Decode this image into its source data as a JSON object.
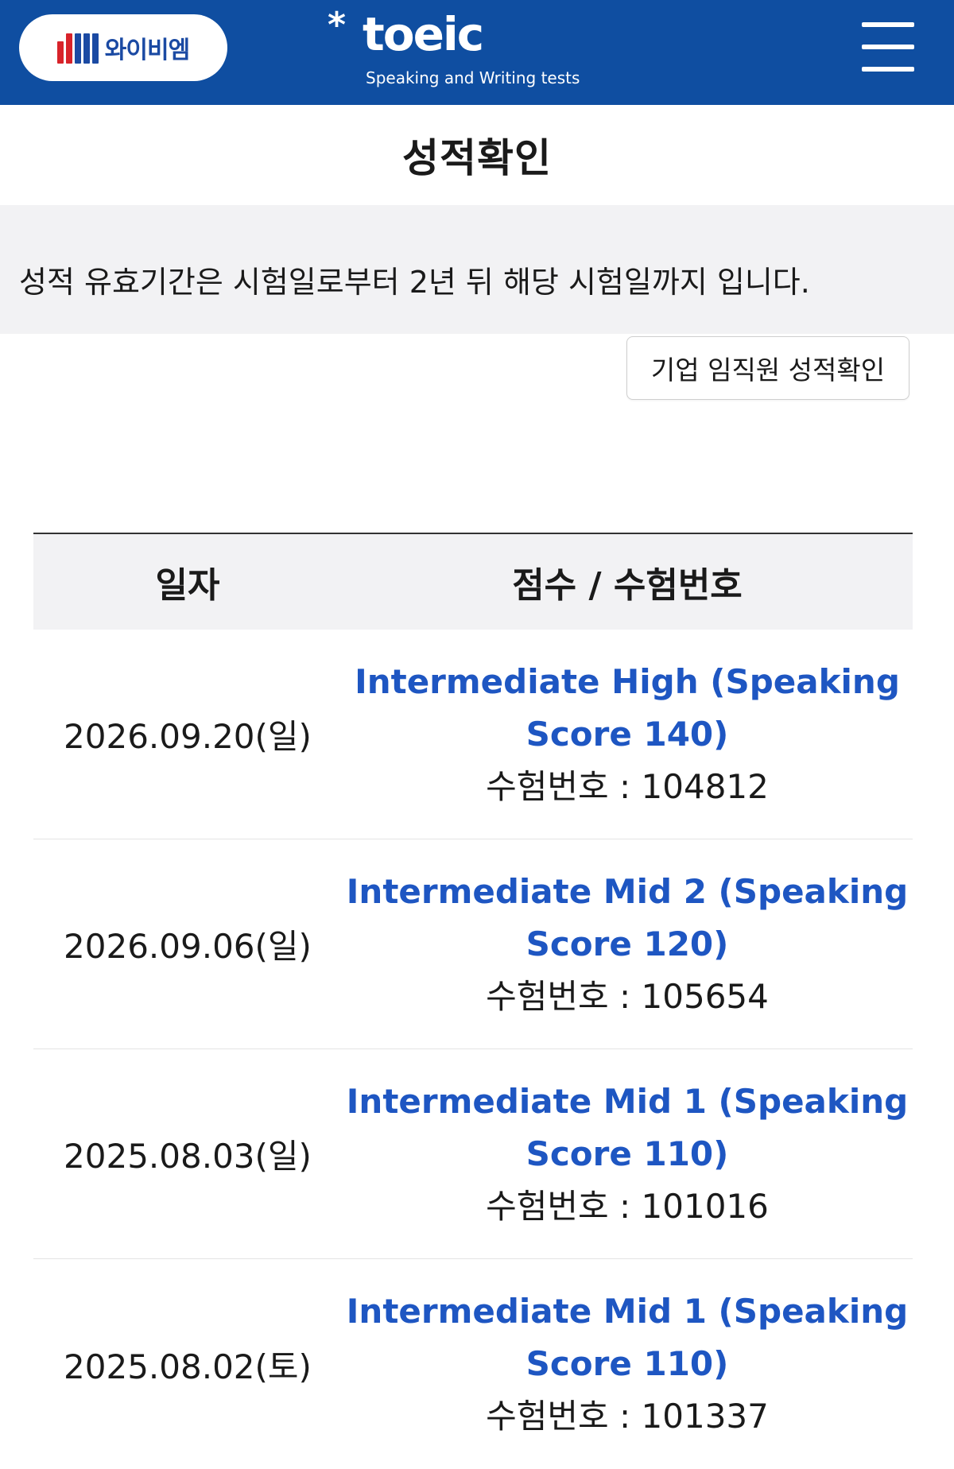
{
  "header": {
    "ybm_logo_text": "와이비엠",
    "toeic_logo_text": "toeic",
    "toeic_logo_star": "*",
    "toeic_logo_subtitle": "Speaking and Writing tests",
    "menu_icon": "hamburger-menu-icon"
  },
  "page": {
    "title": "성적확인"
  },
  "notice": {
    "text": "성적 유효기간은 시험일로부터 2년 뒤 해당 시험일까지 입니다."
  },
  "corporate_button": {
    "label": "기업 임직원 성적확인"
  },
  "table": {
    "headers": {
      "date": "일자",
      "score": "점수 / 수험번호"
    },
    "rows": [
      {
        "date": "2026.09.20(일)",
        "level_line1": "Intermediate High (Speaking",
        "level_line2": "Score 140)",
        "exam_number": "수험번호 : 104812"
      },
      {
        "date": "2026.09.06(일)",
        "level_line1": "Intermediate Mid 2 (Speaking",
        "level_line2": "Score 120)",
        "exam_number": "수험번호 : 105654"
      },
      {
        "date": "2025.08.03(일)",
        "level_line1": "Intermediate Mid 1 (Speaking",
        "level_line2": "Score 110)",
        "exam_number": "수험번호 : 101016"
      },
      {
        "date": "2025.08.02(토)",
        "level_line1": "Intermediate Mid 1 (Speaking",
        "level_line2": "Score 110)",
        "exam_number": "수험번호 : 101337"
      }
    ]
  },
  "colors": {
    "header_bg": "#0f4ea1",
    "score_link": "#1e56c2",
    "table_header_bg": "#f2f2f4",
    "ybm_red": "#d8232a",
    "ybm_blue": "#1b4aa3"
  }
}
